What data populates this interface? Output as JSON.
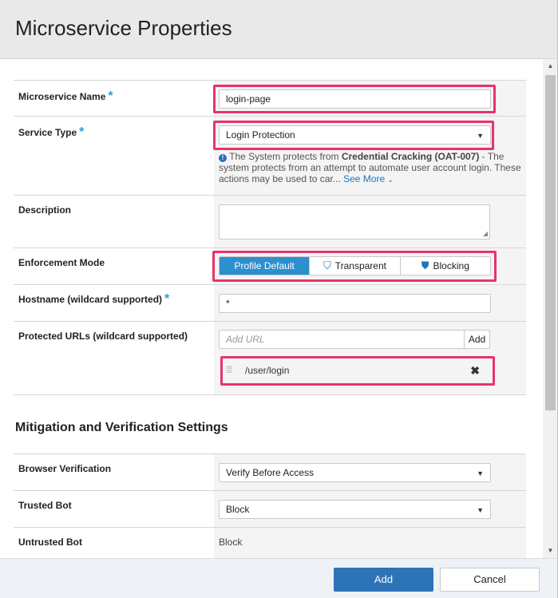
{
  "dialog": {
    "title": "Microservice Properties"
  },
  "fields": {
    "name": {
      "label": "Microservice Name",
      "required_mark": "*",
      "value": "login-page"
    },
    "service_type": {
      "label": "Service Type",
      "required_mark": "*",
      "value": "Login Protection",
      "info_prefix": "The System protects from ",
      "info_bold": "Credential Cracking (OAT-007)",
      "info_suffix": " - The system protects from an attempt to automate user account login. These actions may be used to car...",
      "see_more": "See More"
    },
    "description": {
      "label": "Description",
      "value": ""
    },
    "enforcement": {
      "label": "Enforcement Mode",
      "options": [
        "Profile Default",
        "Transparent",
        "Blocking"
      ],
      "selected": "Profile Default"
    },
    "hostname": {
      "label": "Hostname (wildcard supported)",
      "required_mark": "*",
      "value": "*"
    },
    "protected_urls": {
      "label": "Protected URLs (wildcard supported)",
      "placeholder": "Add URL",
      "add_label": "Add",
      "items": [
        "/user/login"
      ]
    }
  },
  "mitigation": {
    "title": "Mitigation and Verification Settings",
    "browser_verification": {
      "label": "Browser Verification",
      "value": "Verify Before Access"
    },
    "trusted_bot": {
      "label": "Trusted Bot",
      "value": "Block"
    },
    "untrusted_bot": {
      "label": "Untrusted Bot",
      "value": "Block"
    }
  },
  "footer": {
    "add_label": "Add",
    "cancel_label": "Cancel"
  },
  "colors": {
    "highlight": "#e8336b",
    "primary": "#2d73b7",
    "active_segment": "#2c8fce",
    "required": "#2a9fd6"
  },
  "icons": [
    "info-icon",
    "shield-outline-icon",
    "shield-filled-icon",
    "drag-handle-icon",
    "close-icon",
    "chevron-down-icon"
  ]
}
